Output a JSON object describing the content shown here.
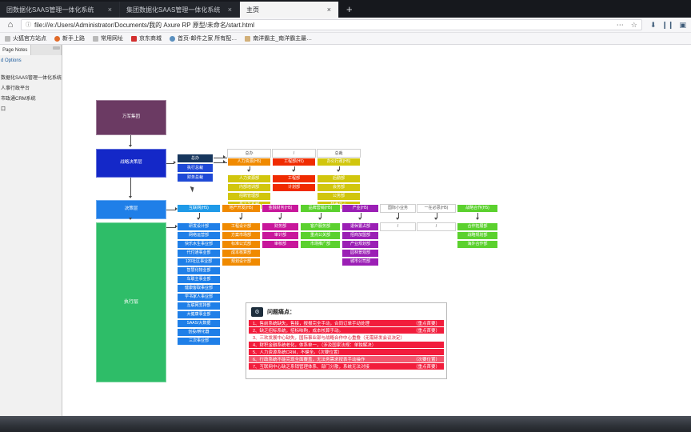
{
  "browser": {
    "tabs": [
      {
        "title": "团数据化SAAS管理一体化系统",
        "close": "×",
        "active": false
      },
      {
        "title": "集团数据化SAAS管理一体化系统",
        "close": "×",
        "active": false
      },
      {
        "title": "主页",
        "close": "×",
        "active": true
      }
    ],
    "new_tab_label": "+",
    "home_icon": "⌂",
    "url": {
      "info_icon": "ⓘ",
      "value": "file:///e:/Users/Administrator/Documents/我的 Axure RP 原型/未命名/start.html",
      "overflow_menu": "⋯",
      "star_icon": "☆"
    },
    "toolbar_icons": [
      {
        "name": "download-icon",
        "glyph": "⬇"
      },
      {
        "name": "library-icon",
        "glyph": "❙❙"
      },
      {
        "name": "sidebar-icon",
        "glyph": "▣"
      }
    ],
    "bookmarks": [
      {
        "label": "火狐官方站点",
        "color": "#b9b9b9"
      },
      {
        "label": "新手上路",
        "color": "#e06a2a"
      },
      {
        "label": "常用网址",
        "color": "#b9b9b9"
      },
      {
        "label": "京东商城",
        "color": "#d32f2f"
      },
      {
        "label": "首页-邮件之家 所有配…",
        "color": "#5a8fbe"
      },
      {
        "label": "南洋霸主_南洋霸主最…",
        "color": "#d2b07a"
      }
    ]
  },
  "sidebar": {
    "tabs": [
      {
        "label": "Page Notes",
        "active": true
      },
      {
        "label": "",
        "active": false
      }
    ],
    "subtitle": "d Options",
    "items": [
      "数据化SAAS管理一体化系统",
      "人事行政平台",
      "市政通CRM系统",
      "口"
    ]
  },
  "diagram": {
    "root": {
      "label": "万军集团",
      "color": "#6b3a63"
    },
    "layers": [
      {
        "label": "战略决策层",
        "color": "#1428c8"
      },
      {
        "label": "决策层",
        "color": "#1f7fe8"
      },
      {
        "label": "执行层",
        "color": "#2ebd68"
      }
    ],
    "exec_group": [
      {
        "label": "总办",
        "color": "#17365d"
      },
      {
        "label": "执行总裁",
        "color": "#1f49d6"
      },
      {
        "label": "财务总裁",
        "color": "#1f49d6"
      }
    ],
    "top_headers": [
      {
        "label": "总办"
      },
      {
        "label": "/"
      },
      {
        "label": "总裁"
      }
    ],
    "top_columns": [
      {
        "head": "人力资源(H5)",
        "head_color": "#f08a00",
        "cells": [
          {
            "label": "人力资源部",
            "color": "#d1c60d"
          },
          {
            "label": "内部培训部",
            "color": "#d1c60d"
          },
          {
            "label": "招聘管理部",
            "color": "#d1c60d"
          },
          {
            "label": "员工关系部",
            "color": "#d1c60d"
          }
        ]
      },
      {
        "head": "工程部(H5)",
        "head_color": "#f02b00",
        "cells": [
          {
            "label": "工程部",
            "color": "#f02b00"
          },
          {
            "label": "计划部",
            "color": "#f02b00"
          }
        ]
      },
      {
        "head": "办公行政(H5)",
        "head_color": "#d1c60d",
        "cells": [
          {
            "label": "后勤部",
            "color": "#d1c60d"
          },
          {
            "label": "会务部",
            "color": "#d1c60d"
          },
          {
            "label": "公务部",
            "color": "#d1c60d"
          },
          {
            "label": "特命中心",
            "color": "#d1c60d"
          }
        ]
      }
    ],
    "mid_columns": [
      {
        "head": "互联网(H5)",
        "head_color": "#1f9ae8",
        "cells": [
          {
            "label": "研发设计部",
            "color": "#1f7fe8"
          },
          {
            "label": "网络运营部",
            "color": "#1f7fe8"
          },
          {
            "label": "快乐水生事业部",
            "color": "#1f7fe8"
          },
          {
            "label": "代付通事业部",
            "color": "#1f7fe8"
          },
          {
            "label": "120社区事业部",
            "color": "#1f7fe8"
          },
          {
            "label": "智慧化物业部",
            "color": "#1f7fe8"
          },
          {
            "label": "车联主事业部",
            "color": "#1f7fe8"
          },
          {
            "label": "健康客取事业部",
            "color": "#1f7fe8"
          },
          {
            "label": "学书家人事业部",
            "color": "#1f7fe8"
          },
          {
            "label": "互联网支持部",
            "color": "#1f7fe8"
          },
          {
            "label": "大健康事业部",
            "color": "#1f7fe8"
          },
          {
            "label": "SAAS/大数据",
            "color": "#1f7fe8"
          },
          {
            "label": "创投/孵化器",
            "color": "#1f7fe8"
          },
          {
            "label": "三次事业部",
            "color": "#1f7fe8"
          }
        ]
      },
      {
        "head": "地产开发(H5)",
        "head_color": "#f08a00",
        "cells": [
          {
            "label": "工程设计部",
            "color": "#f08a00"
          },
          {
            "label": "方案市场部",
            "color": "#f08a00"
          },
          {
            "label": "标准公式部",
            "color": "#f08a00"
          },
          {
            "label": "成本核算部",
            "color": "#f08a00"
          },
          {
            "label": "规划设计部",
            "color": "#f08a00"
          }
        ]
      },
      {
        "head": "金融财务(H5)",
        "head_color": "#c8179b",
        "cells": [
          {
            "label": "财务部",
            "color": "#c8179b"
          },
          {
            "label": "审计部",
            "color": "#c8179b"
          },
          {
            "label": "审核部",
            "color": "#c8179b"
          }
        ]
      },
      {
        "head": "品牌营销(H5)",
        "head_color": "#5bd12e",
        "cells": [
          {
            "label": "客户服务部",
            "color": "#5bd12e"
          },
          {
            "label": "重点公关部",
            "color": "#5bd12e"
          },
          {
            "label": "市场推广部",
            "color": "#5bd12e"
          }
        ]
      },
      {
        "head": "产业(H5)",
        "head_color": "#9b1fb5",
        "cells": [
          {
            "label": "退休置占部",
            "color": "#9b1fb5"
          },
          {
            "label": "招商加盟部",
            "color": "#9b1fb5"
          },
          {
            "label": "产业规划部",
            "color": "#9b1fb5"
          },
          {
            "label": "园林景观部",
            "color": "#9b1fb5"
          },
          {
            "label": "城市公司部",
            "color": "#9b1fb5"
          }
        ]
      },
      {
        "head": "国际小业务",
        "head_color": "#ffffff",
        "head_text": "#555",
        "cells": [
          {
            "label": "/",
            "color": "#ffffff",
            "text": "#555"
          }
        ]
      },
      {
        "head": "一在必思(H5)",
        "head_color": "#ffffff",
        "head_text": "#555",
        "cells": [
          {
            "label": "/",
            "color": "#ffffff",
            "text": "#555"
          }
        ]
      },
      {
        "head": "战略合作(H5)",
        "head_color": "#5bd12e",
        "cells": [
          {
            "label": "合作拓展部",
            "color": "#5bd12e"
          },
          {
            "label": "战略规划部",
            "color": "#5bd12e"
          },
          {
            "label": "海外合作部",
            "color": "#5bd12e"
          }
        ]
      }
    ]
  },
  "panel": {
    "badge_icon": "⚙",
    "title": "问题痛点：",
    "rows": [
      {
        "text": "1、售前系统缺失，售接，报报完全手动，合同订单手动处理",
        "tag": "（重点首要）",
        "bg": "#f21d3c",
        "color": "#ffffff"
      },
      {
        "text": "2、缺乏招标系统，招标味购，成本核算手动。",
        "tag": "（重点首要）",
        "bg": "#f21d3c",
        "color": "#ffffff"
      },
      {
        "text": "3、三欢发展中心缺失，国际事业部与战略合作中心重叠（无需研发会议决定）",
        "tag": "",
        "bg": "#ffffff",
        "color": "#d81a34"
      },
      {
        "text": "4、财积金融系统老化，体系单一，（涉及国家法规：单独解决）",
        "tag": "",
        "bg": "#f21d3c",
        "color": "#ffffff"
      },
      {
        "text": "5、人力资源系统CRM，不健全。（次要位置）",
        "tag": "",
        "bg": "#f21d3c",
        "color": "#ffffff"
      },
      {
        "text": "6、行政系统不能完现全面覆盖，无法务需求按表手动操作",
        "tag": "（次要位置）",
        "bg": "#f2576e",
        "color": "#ffffff"
      },
      {
        "text": "7、互联网中心缺乏系销管理体系、部门分散，系统无法对接",
        "tag": "（重点首要）",
        "bg": "#f21d3c",
        "color": "#ffffff"
      }
    ]
  }
}
